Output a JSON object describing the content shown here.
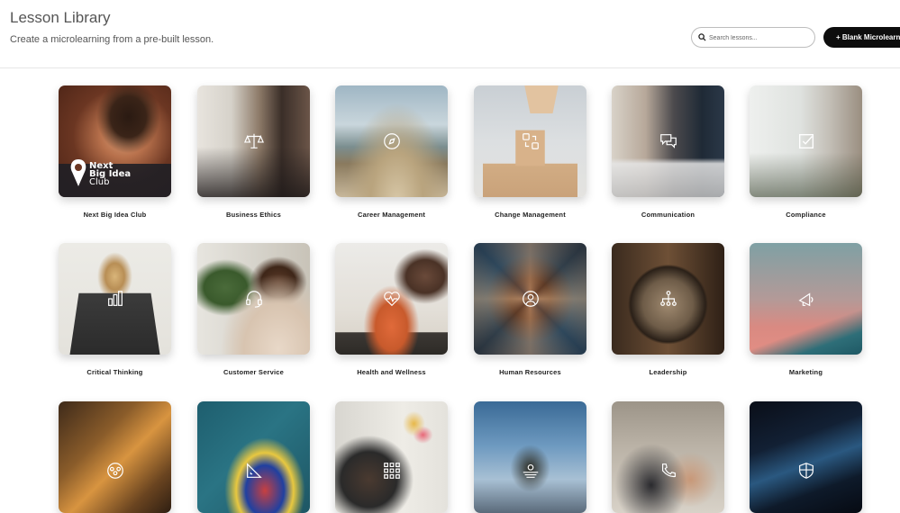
{
  "header": {
    "title": "Lesson Library",
    "subtitle": "Create a microlearning from a pre-built lesson.",
    "search_placeholder": "Search lessons...",
    "blank_button": "+ Blank Microlearning"
  },
  "lessons": [
    {
      "label": "Next Big Idea Club",
      "logo_lines": [
        "Next",
        "Big Idea",
        "Club"
      ]
    },
    {
      "label": "Business Ethics",
      "icon": "scales-icon"
    },
    {
      "label": "Career Management",
      "icon": "compass-icon"
    },
    {
      "label": "Change Management",
      "icon": "change-arrows-icon"
    },
    {
      "label": "Communication",
      "icon": "chat-bubbles-icon"
    },
    {
      "label": "Compliance",
      "icon": "checkbox-icon"
    },
    {
      "label": "Critical Thinking",
      "icon": "bar-chart-icon"
    },
    {
      "label": "Customer Service",
      "icon": "headset-icon"
    },
    {
      "label": "Health and Wellness",
      "icon": "heart-pulse-icon"
    },
    {
      "label": "Human Resources",
      "icon": "person-circle-icon"
    },
    {
      "label": "Leadership",
      "icon": "org-chart-icon"
    },
    {
      "label": "Marketing",
      "icon": "megaphone-icon"
    },
    {
      "label": "",
      "icon": "team-icon"
    },
    {
      "label": "",
      "icon": "ruler-triangle-icon"
    },
    {
      "label": "",
      "icon": "grid-icon"
    },
    {
      "label": "",
      "icon": "sunrise-icon"
    },
    {
      "label": "",
      "icon": "handshake-phone-icon"
    },
    {
      "label": "",
      "icon": "shield-icon"
    }
  ]
}
